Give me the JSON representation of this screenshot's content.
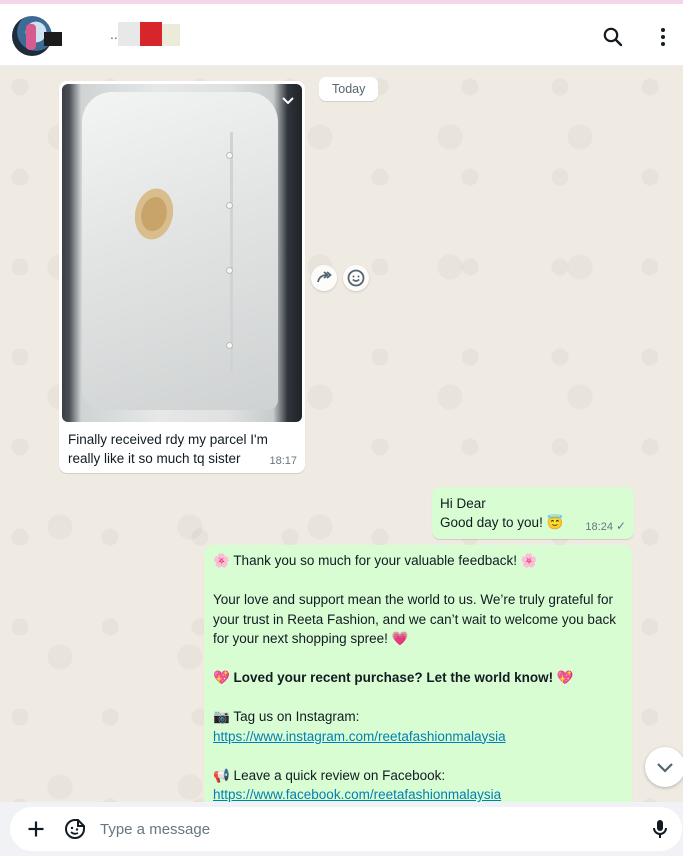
{
  "header": {
    "contact_name": "...ka",
    "icons": {
      "search": "search-icon",
      "menu": "menu-icon"
    }
  },
  "chat": {
    "date_chip": "Today",
    "incoming": {
      "caption": "Finally received rdy my parcel I'm really like it so much tq sister",
      "time": "18:17"
    },
    "outgoing_1": {
      "line1": "Hi Dear",
      "line2": "Good day to you! 😇",
      "time": "18:24",
      "status": "✓"
    },
    "outgoing_2": {
      "p1": "🌸 Thank you so much for your valuable feedback! 🌸",
      "p2": "Your love and support mean the world to us. We’re truly grateful for your trust in Reeta Fashion, and we can’t wait to welcome you back for your next shopping spree! 💗",
      "p3": "💖 Loved your recent purchase? Let the world know! 💖",
      "instagram_label": "📷 Tag us on Instagram:",
      "instagram_link": "https://www.instagram.com/reetafashionmalaysia",
      "facebook_label": "📢 Leave a quick review on Facebook:",
      "facebook_link": "https://www.facebook.com/reetafashionmalaysia"
    }
  },
  "composer": {
    "placeholder": "Type a message",
    "icons": {
      "attach": "plus-icon",
      "sticker": "sticker-icon",
      "voice": "mic-icon"
    }
  },
  "colors": {
    "chat_bg": "#efeae2",
    "outgoing_bubble": "#d9fdd3",
    "link": "#027eb5",
    "meta_text": "#667781"
  }
}
